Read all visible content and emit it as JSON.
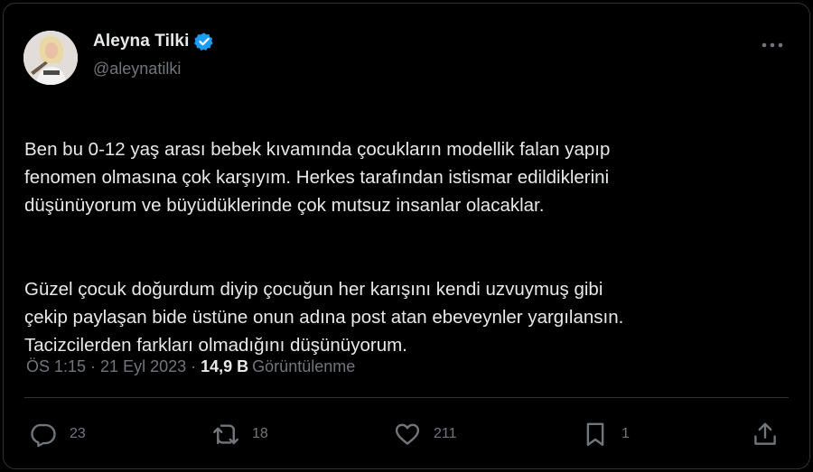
{
  "author": {
    "display_name": "Aleyna Tilki",
    "handle": "@aleynatilki",
    "verified": true,
    "avatar_icon": "profile-photo",
    "verified_color": "#1d9bf0"
  },
  "menu": {
    "more_icon": "more-dots-icon"
  },
  "tweet": {
    "paragraphs": [
      "Ben bu 0-12 yaş arası bebek kıvamında çocukların modellik falan yapıp\nfenomen olmasına çok karşıyım. Herkes tarafından istismar edildiklerini\ndüşünüyorum ve büyüdüklerinde çok mutsuz insanlar olacaklar.",
      "Güzel çocuk doğurdum diyip çocuğun her  karışını kendi uzvuymuş gibi\nçekip paylaşan bide üstüne onun adına post atan ebeveynler yargılansın.\nTacizcilerden farkları olmadığını düşünüyorum."
    ]
  },
  "meta": {
    "time": "ÖS 1:15",
    "separator": "·",
    "date": "21 Eyl 2023",
    "views_count": "14,9 B",
    "views_label": "Görüntülenme"
  },
  "actions": {
    "reply": {
      "icon": "reply-icon",
      "count": "23"
    },
    "retweet": {
      "icon": "retweet-icon",
      "count": "18"
    },
    "like": {
      "icon": "heart-icon",
      "count": "211"
    },
    "bookmark": {
      "icon": "bookmark-icon",
      "count": "1"
    },
    "share": {
      "icon": "share-icon"
    }
  },
  "colors": {
    "background": "#000000",
    "text_primary": "#e7e9ea",
    "text_secondary": "#71767b",
    "border": "#2f3336"
  }
}
